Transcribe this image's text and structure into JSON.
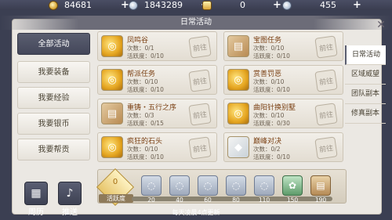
{
  "currency": [
    {
      "icon": "gold-coin-icon",
      "value": "84681"
    },
    {
      "icon": "silver-coin-icon",
      "value": "1843289"
    },
    {
      "icon": "gold-ingot-icon",
      "value": "0"
    },
    {
      "icon": "silver-ingot-icon",
      "value": "455"
    }
  ],
  "panel": {
    "title": "日常活动"
  },
  "left_nav": [
    "全部活动",
    "我要装备",
    "我要经验",
    "我要银币",
    "我要帮贡"
  ],
  "right_nav": [
    "日常活动",
    "区域威望",
    "团队副本",
    "修真副本"
  ],
  "goto_label": "前往",
  "activities": [
    {
      "name": "凤鸣谷",
      "count": "次数：0/1",
      "active": "活跃度：0/10",
      "icon": "gold-coin-icon"
    },
    {
      "name": "宝图任务",
      "count": "次数：0/10",
      "active": "活跃度：0/10",
      "icon": "map-scroll-icon"
    },
    {
      "name": "帮派任务",
      "count": "次数：0/10",
      "active": "活跃度：0/10",
      "icon": "gold-coin-icon"
    },
    {
      "name": "赏善罚恶",
      "count": "次数：0/10",
      "active": "活跃度：0/10",
      "icon": "gold-coin-icon"
    },
    {
      "name": "重铸・五行之序",
      "count": "次数：0/3",
      "active": "活跃度：0/15",
      "icon": "scroll-icon"
    },
    {
      "name": "曲阳针换别墅",
      "count": "次数：0/10",
      "active": "活跃度：0/30",
      "icon": "gold-coin-icon"
    },
    {
      "name": "疯狂的石头",
      "count": "次数：0/10",
      "active": "活跃度：0/10",
      "icon": "gold-coin-icon"
    },
    {
      "name": "巅峰对决",
      "count": "次数：0/2",
      "active": "活跃度：0/10",
      "icon": "crystal-icon"
    }
  ],
  "activity_points": {
    "value": "0",
    "label": "活跃度",
    "progress": 0
  },
  "reward_ticks": [
    "20",
    "40",
    "60",
    "80",
    "110",
    "150",
    "190"
  ],
  "footer_note": "每天凌晨4点更新",
  "bottom_buttons": [
    "周历",
    "推送"
  ]
}
